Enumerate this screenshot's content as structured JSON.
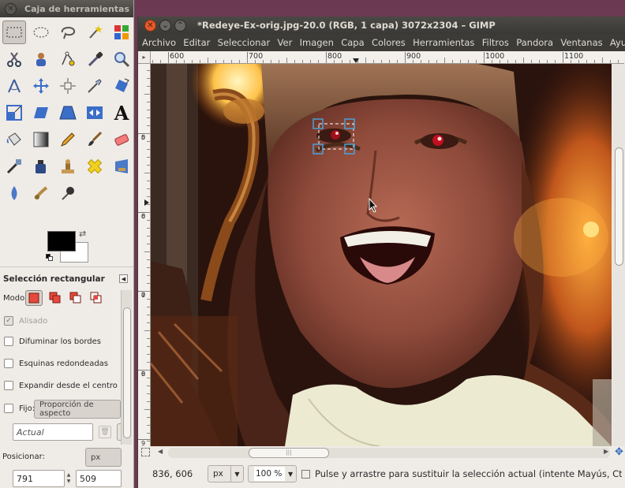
{
  "toolbox": {
    "title": "Caja de herramientas",
    "tools": [
      "rect-select",
      "ellipse-select",
      "free-select",
      "fuzzy-select",
      "by-color-select",
      "scissors-select",
      "foreground-select",
      "paths",
      "color-picker",
      "zoom",
      "measure",
      "move",
      "alignment",
      "crop",
      "rotate",
      "scale",
      "shear",
      "perspective",
      "flip",
      "text",
      "bucket-fill",
      "blend",
      "pencil",
      "paintbrush",
      "eraser",
      "airbrush",
      "ink",
      "clone",
      "heal",
      "perspective-clone",
      "blur",
      "smudge",
      "dodge-burn"
    ],
    "colors": {
      "foreground": "#000000",
      "background": "#ffffff"
    }
  },
  "tool_options": {
    "title": "Selección rectangular",
    "mode_label": "Modo:",
    "antialias_label": "Alisado",
    "feather_label": "Difuminar los bordes",
    "rounded_label": "Esquinas redondeadas",
    "expand_label": "Expandir desde el centro",
    "fixed_label": "Fijo:",
    "fixed_value": "Proporción de aspecto",
    "current_value": "Actual",
    "position_label": "Posicionar:",
    "position_unit": "px",
    "position_x": "791",
    "position_y": "509"
  },
  "image_window": {
    "title": "*Redeye-Ex-orig.jpg-20.0 (RGB, 1 capa) 3072x2304 – GIMP",
    "menu": [
      "Archivo",
      "Editar",
      "Seleccionar",
      "Ver",
      "Imagen",
      "Capa",
      "Colores",
      "Herramientas",
      "Filtros",
      "Pandora",
      "Ventanas",
      "Ayuda"
    ],
    "ruler_h": [
      "600",
      "700",
      "800",
      "900",
      "1000",
      "1100"
    ],
    "ruler_v": [
      "5",
      "0",
      "0",
      "6",
      "0",
      "0",
      "7",
      "0",
      "0",
      "8",
      "0",
      "0",
      "9"
    ],
    "status": {
      "coords": "836, 606",
      "unit": "px",
      "zoom": "100 %",
      "message": "Pulse y arrastre para sustituir la selección actual (intente Mayús, Ctr..."
    }
  }
}
